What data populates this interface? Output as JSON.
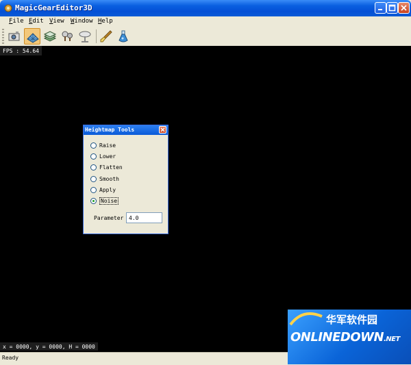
{
  "window": {
    "title": "MagicGearEditor3D"
  },
  "menu": [
    "File",
    "Edit",
    "View",
    "Window",
    "Help"
  ],
  "toolbar": {
    "buttons": [
      {
        "icon": "camera-icon",
        "active": false
      },
      {
        "icon": "terrain-grid-icon",
        "active": true
      },
      {
        "icon": "layers-icon",
        "active": false
      },
      {
        "icon": "trees-icon",
        "active": false
      },
      {
        "icon": "sky-icon",
        "active": false
      },
      {
        "icon": "brush-icon",
        "active": false
      },
      {
        "icon": "potion-icon",
        "active": false
      }
    ]
  },
  "viewport": {
    "fps": "FPS : 54.64",
    "coords": "x = 0000, y = 0000, H = 0000"
  },
  "dialog": {
    "title": "Heightmap Tools",
    "options": [
      {
        "label": "Raise",
        "selected": false
      },
      {
        "label": "Lower",
        "selected": false
      },
      {
        "label": "Flatten",
        "selected": false
      },
      {
        "label": "Smooth",
        "selected": false
      },
      {
        "label": "Apply",
        "selected": false
      },
      {
        "label": "Noise",
        "selected": true
      }
    ],
    "parameter_label": "Parameter",
    "parameter_value": "4.0"
  },
  "status": {
    "text": "Ready"
  },
  "watermark": {
    "chinese": "华军软件园",
    "english_main": "ONLINEDOWN",
    "english_suffix": ".NET"
  },
  "colors": {
    "titlebar": "#0a5fe0",
    "viewport": "#000000",
    "dialog_title": "#0a5ad8",
    "active_tool": "#f3c87a"
  }
}
